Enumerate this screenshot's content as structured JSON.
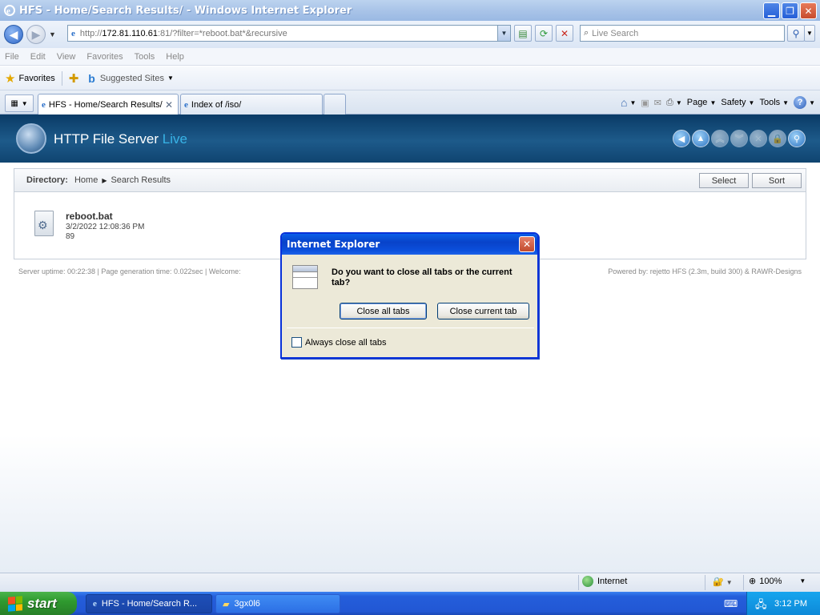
{
  "window": {
    "title": "HFS - Home/Search Results/ - Windows Internet Explorer",
    "minimize": "▁",
    "maximize": "❐",
    "close": "✕"
  },
  "address": {
    "url_prefix": "http://",
    "url_host": "172.81.110.61",
    "url_rest": ":81/?filter=*reboot.bat*&recursive",
    "search_placeholder": "Live Search"
  },
  "menu": [
    "File",
    "Edit",
    "View",
    "Favorites",
    "Tools",
    "Help"
  ],
  "favorites": {
    "label": "Favorites",
    "suggested": "Suggested Sites"
  },
  "tabs": [
    {
      "label": "HFS - Home/Search Results/"
    },
    {
      "label": "Index of /iso/"
    }
  ],
  "commandbar": {
    "page": "Page",
    "safety": "Safety",
    "tools": "Tools"
  },
  "hfs": {
    "title": "HTTP File Server",
    "title_accent": "Live",
    "directory_label": "Directory:",
    "crumbs": [
      "Home",
      "Search Results"
    ],
    "select_label": "Select",
    "sort_label": "Sort",
    "file": {
      "name": "reboot.bat",
      "date": "3/2/2022 12:08:36 PM",
      "size": "89"
    },
    "footer_left": "Server uptime:  00:22:38   |   Page generation time:  0.022sec   |   Welcome:",
    "footer_right": "Powered by: rejetto HFS (2.3m, build 300) & RAWR-Designs"
  },
  "dialog": {
    "title": "Internet Explorer",
    "message": "Do you want to close all tabs or the current tab?",
    "close_all": "Close all tabs",
    "close_current": "Close current tab",
    "always_label": "Always close all tabs",
    "always_checked": false
  },
  "status": {
    "zone": "Internet",
    "zoom": "100%"
  },
  "taskbar": {
    "start": "start",
    "items": [
      "HFS - Home/Search R...",
      "3gx0l6"
    ],
    "clock": "3:12 PM"
  }
}
